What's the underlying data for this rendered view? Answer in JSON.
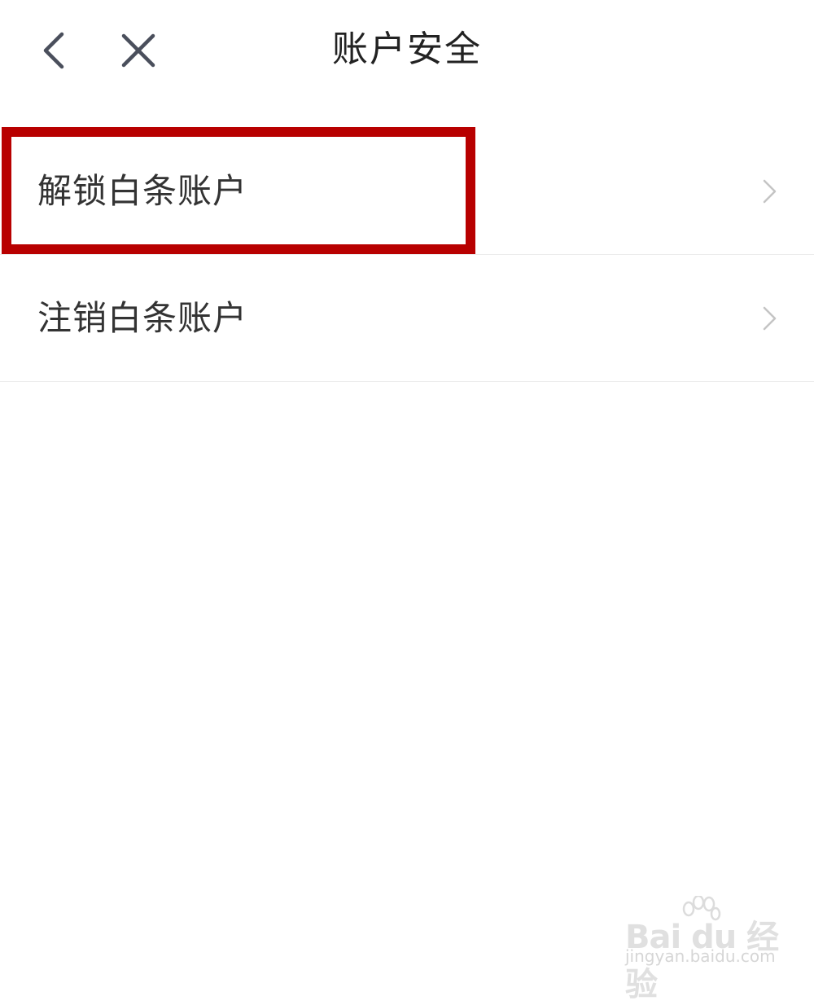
{
  "header": {
    "title": "账户安全",
    "back_icon": "chevron-left-icon",
    "close_icon": "close-icon"
  },
  "menu": {
    "items": [
      {
        "label": "解锁白条账户",
        "icon": "chevron-right-icon"
      },
      {
        "label": "注销白条账户",
        "icon": "chevron-right-icon"
      }
    ]
  },
  "annotation": {
    "highlight_color": "#b80000"
  },
  "watermark": {
    "logo": "Bai du 经验",
    "url": "jingyan.baidu.com"
  }
}
